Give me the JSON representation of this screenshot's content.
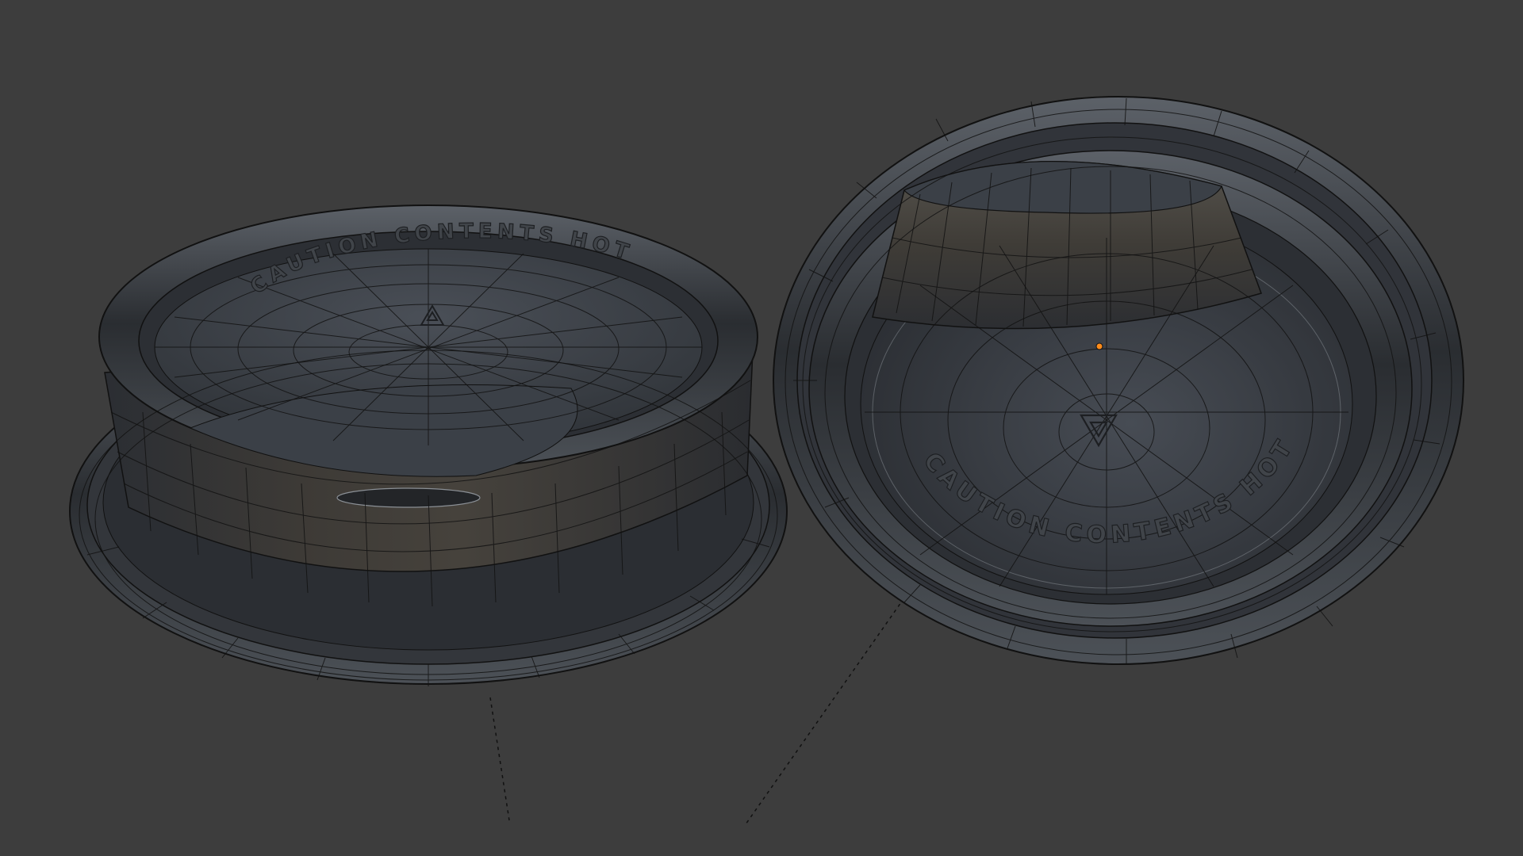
{
  "viewport": {
    "background": "#3d3d3d",
    "wire_color": "#121212",
    "surface_color": "#3a3f46",
    "highlight_color": "#8a8f95",
    "origin_dot_color": "#ff8c1a"
  },
  "objects": [
    {
      "name": "cup-lid-top-view",
      "embossed_text": "CAUTION CONTENTS HOT",
      "emboss_icon": "recycle-icon"
    },
    {
      "name": "cup-lid-bottom-view",
      "embossed_text": "CAUTION CONTENTS HOT",
      "emboss_icon": "recycle-icon"
    }
  ]
}
